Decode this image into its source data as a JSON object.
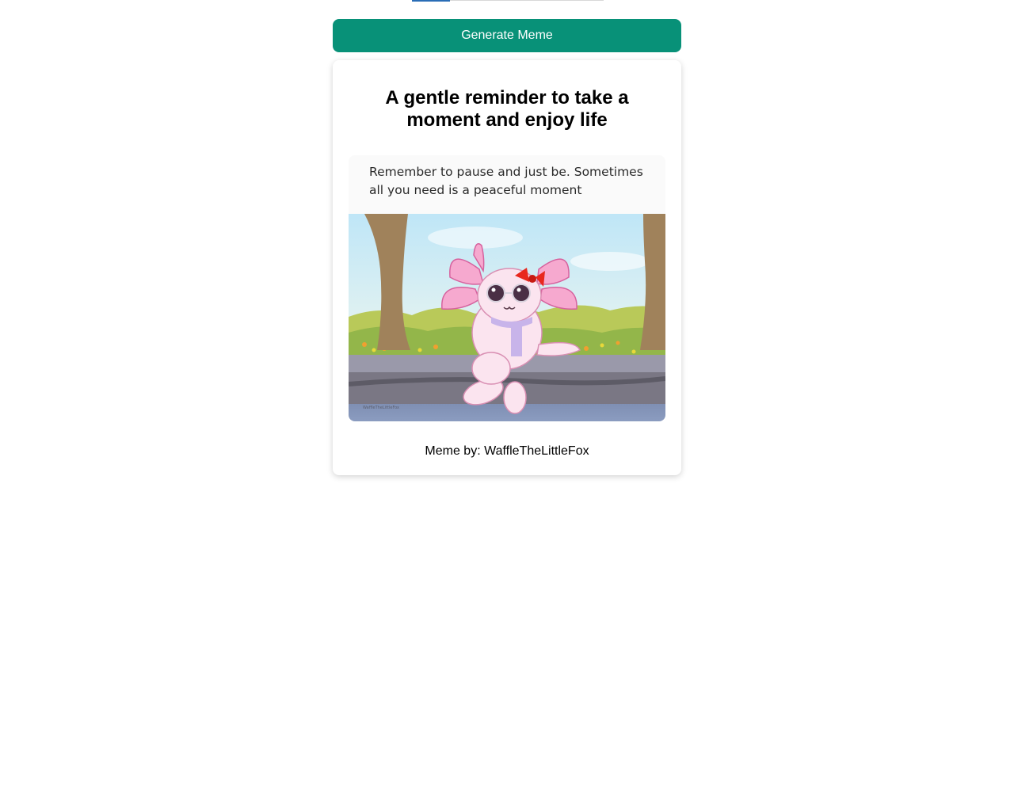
{
  "toolbar": {
    "generate_label": "Generate Meme"
  },
  "meme": {
    "title": "A gentle reminder to take a moment and enjoy life",
    "caption": "Remember to pause and just be. Sometimes all you need is a peaceful moment",
    "credit": "Meme by: WaffleTheLittleFox"
  },
  "colors": {
    "accent": "#089178",
    "tab_active": "#2a6db6"
  }
}
